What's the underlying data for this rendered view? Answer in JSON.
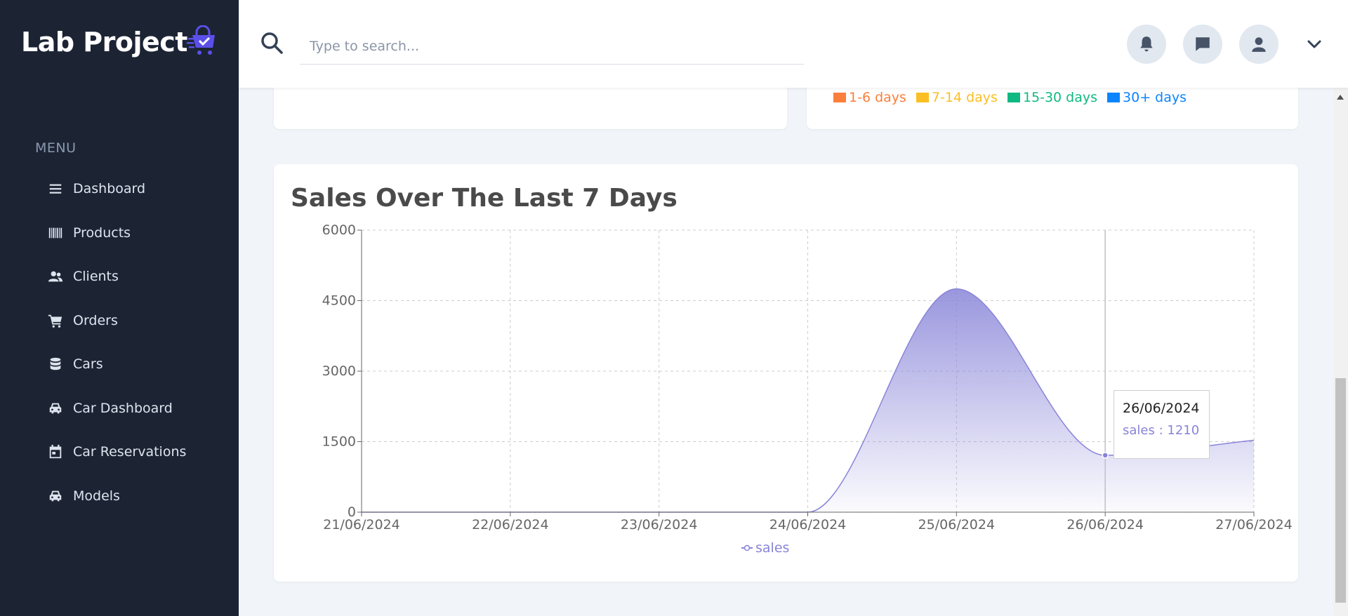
{
  "brand": {
    "title": "Lab Project",
    "logo_icon": "shopping-cart-check-icon"
  },
  "sidebar": {
    "menu_heading": "MENU",
    "items": [
      {
        "label": "Dashboard",
        "icon": "menu-icon"
      },
      {
        "label": "Products",
        "icon": "barcode-icon"
      },
      {
        "label": "Clients",
        "icon": "users-icon"
      },
      {
        "label": "Orders",
        "icon": "cart-icon"
      },
      {
        "label": "Cars",
        "icon": "database-icon"
      },
      {
        "label": "Car Dashboard",
        "icon": "car-icon"
      },
      {
        "label": "Car Reservations",
        "icon": "calendar-icon"
      },
      {
        "label": "Models",
        "icon": "car-icon"
      }
    ]
  },
  "header": {
    "search_placeholder": "Type to search...",
    "search_value": ""
  },
  "age_legend": [
    {
      "label": "1-6 days",
      "color": "#fb7f3c"
    },
    {
      "label": "7-14 days",
      "color": "#fbbf24"
    },
    {
      "label": "15-30 days",
      "color": "#10b981"
    },
    {
      "label": "30+ days",
      "color": "#0b84fe"
    }
  ],
  "chart_data": {
    "type": "area",
    "title": "Sales Over The Last 7 Days",
    "x": [
      "21/06/2024",
      "22/06/2024",
      "23/06/2024",
      "24/06/2024",
      "25/06/2024",
      "26/06/2024",
      "27/06/2024"
    ],
    "series": [
      {
        "name": "sales",
        "values": [
          0,
          0,
          0,
          0,
          4750,
          1210,
          1530
        ],
        "color": "#8884d8"
      }
    ],
    "ylim": [
      0,
      6000
    ],
    "yticks": [
      0,
      1500,
      3000,
      4500,
      6000
    ],
    "grid": true,
    "legend": "bottom-center",
    "tooltip": {
      "date": "26/06/2024",
      "label": "sales",
      "value": "1210"
    }
  }
}
